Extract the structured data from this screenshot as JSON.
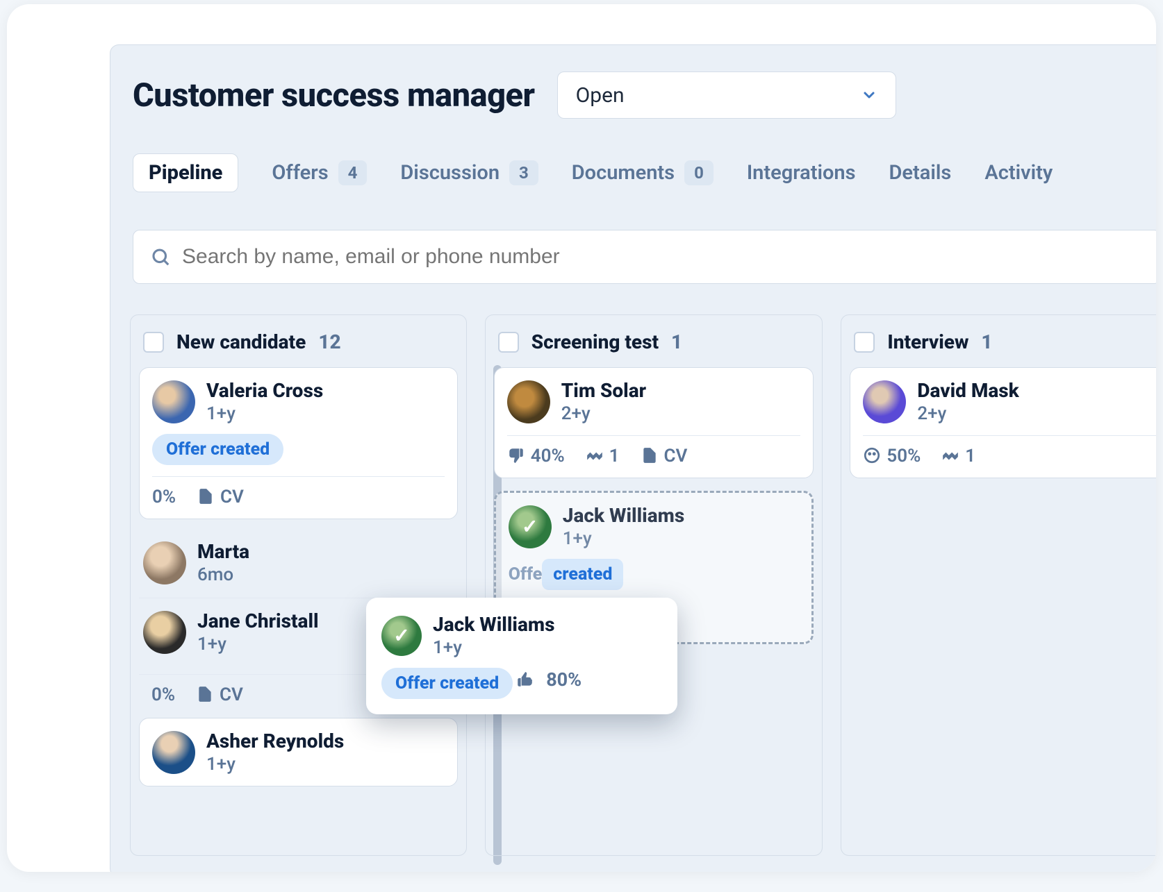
{
  "page": {
    "title": "Customer success manager",
    "status": {
      "value": "Open"
    }
  },
  "tabs": {
    "pipeline": "Pipeline",
    "offers": {
      "label": "Offers",
      "count": "4"
    },
    "discussion": {
      "label": "Discussion",
      "count": "3"
    },
    "documents": {
      "label": "Documents",
      "count": "0"
    },
    "integrations": "Integrations",
    "details": "Details",
    "activity": "Activity"
  },
  "search": {
    "placeholder": "Search by name, email or phone number"
  },
  "columns": {
    "new": {
      "title": "New candidate",
      "count": "12"
    },
    "screening": {
      "title": "Screening test",
      "count": "1"
    },
    "interview": {
      "title": "Interview",
      "count": "1"
    }
  },
  "cards": {
    "valeria": {
      "name": "Valeria Cross",
      "sub": "1+y",
      "tag": "Offer created",
      "footer_percent": "0%",
      "footer_cv": "CV"
    },
    "marta": {
      "name": "Marta",
      "sub": "6mo"
    },
    "jane": {
      "name": "Jane Christall",
      "sub": "1+y",
      "footer_percent": "0%",
      "footer_cv": "CV"
    },
    "asher": {
      "name": "Asher Reynolds",
      "sub": "1+y"
    },
    "tim": {
      "name": "Tim Solar",
      "sub": "2+y",
      "footer_percent": "40%",
      "footer_handshake": "1",
      "footer_cv": "CV"
    },
    "jack": {
      "name": "Jack Williams",
      "sub": "1+y",
      "tag": "Offer created",
      "thumb": "80%",
      "ghost_tag_left": "Offe",
      "ghost_tag_right": "created"
    },
    "david": {
      "name": "David Mask",
      "sub": "2+y",
      "footer_percent": "50%",
      "footer_handshake": "1"
    }
  }
}
